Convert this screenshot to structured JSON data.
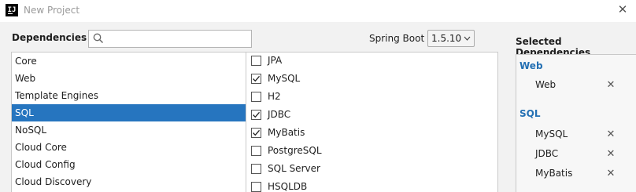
{
  "window": {
    "title": "New Project",
    "app_icon": "intellij-idea-icon",
    "app_icon_text": "IJ"
  },
  "dependencies": {
    "label": "Dependencies",
    "search": {
      "value": "",
      "placeholder": ""
    }
  },
  "spring_boot": {
    "label": "Spring Boot",
    "selected_version": "1.5.10"
  },
  "categories": [
    {
      "label": "Core",
      "selected": false
    },
    {
      "label": "Web",
      "selected": false
    },
    {
      "label": "Template Engines",
      "selected": false
    },
    {
      "label": "SQL",
      "selected": true
    },
    {
      "label": "NoSQL",
      "selected": false
    },
    {
      "label": "Cloud Core",
      "selected": false
    },
    {
      "label": "Cloud Config",
      "selected": false
    },
    {
      "label": "Cloud Discovery",
      "selected": false
    }
  ],
  "sql_dependencies": [
    {
      "label": "JPA",
      "checked": false
    },
    {
      "label": "MySQL",
      "checked": true
    },
    {
      "label": "H2",
      "checked": false
    },
    {
      "label": "JDBC",
      "checked": true
    },
    {
      "label": "MyBatis",
      "checked": true
    },
    {
      "label": "PostgreSQL",
      "checked": false
    },
    {
      "label": "SQL Server",
      "checked": false
    },
    {
      "label": "HSQLDB",
      "checked": false
    }
  ],
  "selected_dependencies": {
    "title": "Selected Dependencies",
    "remove_icon": "close-x-icon",
    "groups": [
      {
        "name": "Web",
        "items": [
          "Web"
        ]
      },
      {
        "name": "SQL",
        "items": [
          "MySQL",
          "JDBC",
          "MyBatis"
        ]
      }
    ]
  },
  "colors": {
    "selection": "#2675bf",
    "group_heading": "#2470b3"
  }
}
